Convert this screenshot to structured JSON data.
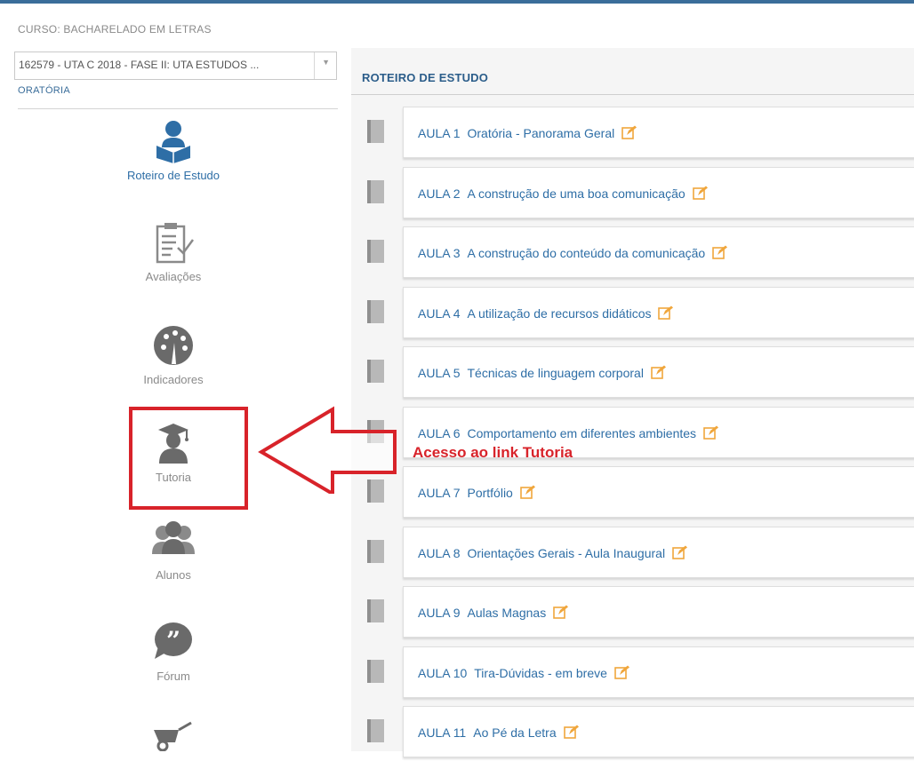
{
  "sidebar": {
    "course_label": "CURSO: BACHARELADO EM LETRAS",
    "class_select_value": "162579 - UTA C 2018 - FASE II: UTA ESTUDOS ...",
    "subject": "ORATÓRIA",
    "nav": [
      {
        "label": "Roteiro de Estudo",
        "icon": "student-book-icon",
        "active": true
      },
      {
        "label": "Avaliações",
        "icon": "clipboard-check-icon"
      },
      {
        "label": "Indicadores",
        "icon": "gauge-icon"
      },
      {
        "label": "Tutoria",
        "icon": "graduate-cap-icon"
      },
      {
        "label": "Alunos",
        "icon": "group-icon"
      },
      {
        "label": "Fórum",
        "icon": "quote-bubble-icon"
      },
      {
        "label": "",
        "icon": "wheelbarrow-icon"
      }
    ]
  },
  "main": {
    "title": "ROTEIRO DE ESTUDO",
    "lessons": [
      {
        "num": "AULA 1",
        "title": "Oratória - Panorama Geral"
      },
      {
        "num": "AULA 2",
        "title": "A construção de uma boa comunicação"
      },
      {
        "num": "AULA 3",
        "title": "A construção do conteúdo da comunicação"
      },
      {
        "num": "AULA 4",
        "title": "A utilização de recursos didáticos"
      },
      {
        "num": "AULA 5",
        "title": "Técnicas de linguagem corporal"
      },
      {
        "num": "AULA 6",
        "title": "Comportamento em diferentes ambientes"
      },
      {
        "num": "AULA 7",
        "title": "Portfólio"
      },
      {
        "num": "AULA 8",
        "title": "Orientações Gerais - Aula Inaugural"
      },
      {
        "num": "AULA 9",
        "title": "Aulas Magnas"
      },
      {
        "num": "AULA 10",
        "title": "Tira-Dúvidas - em breve"
      },
      {
        "num": "AULA 11",
        "title": "Ao Pé da Letra"
      }
    ]
  },
  "annotation": {
    "text": "Acesso ao link Tutoria"
  },
  "colors": {
    "accent": "#2e6ea6",
    "annotation": "#d8232a",
    "edit_icon": "#f0a63c"
  }
}
